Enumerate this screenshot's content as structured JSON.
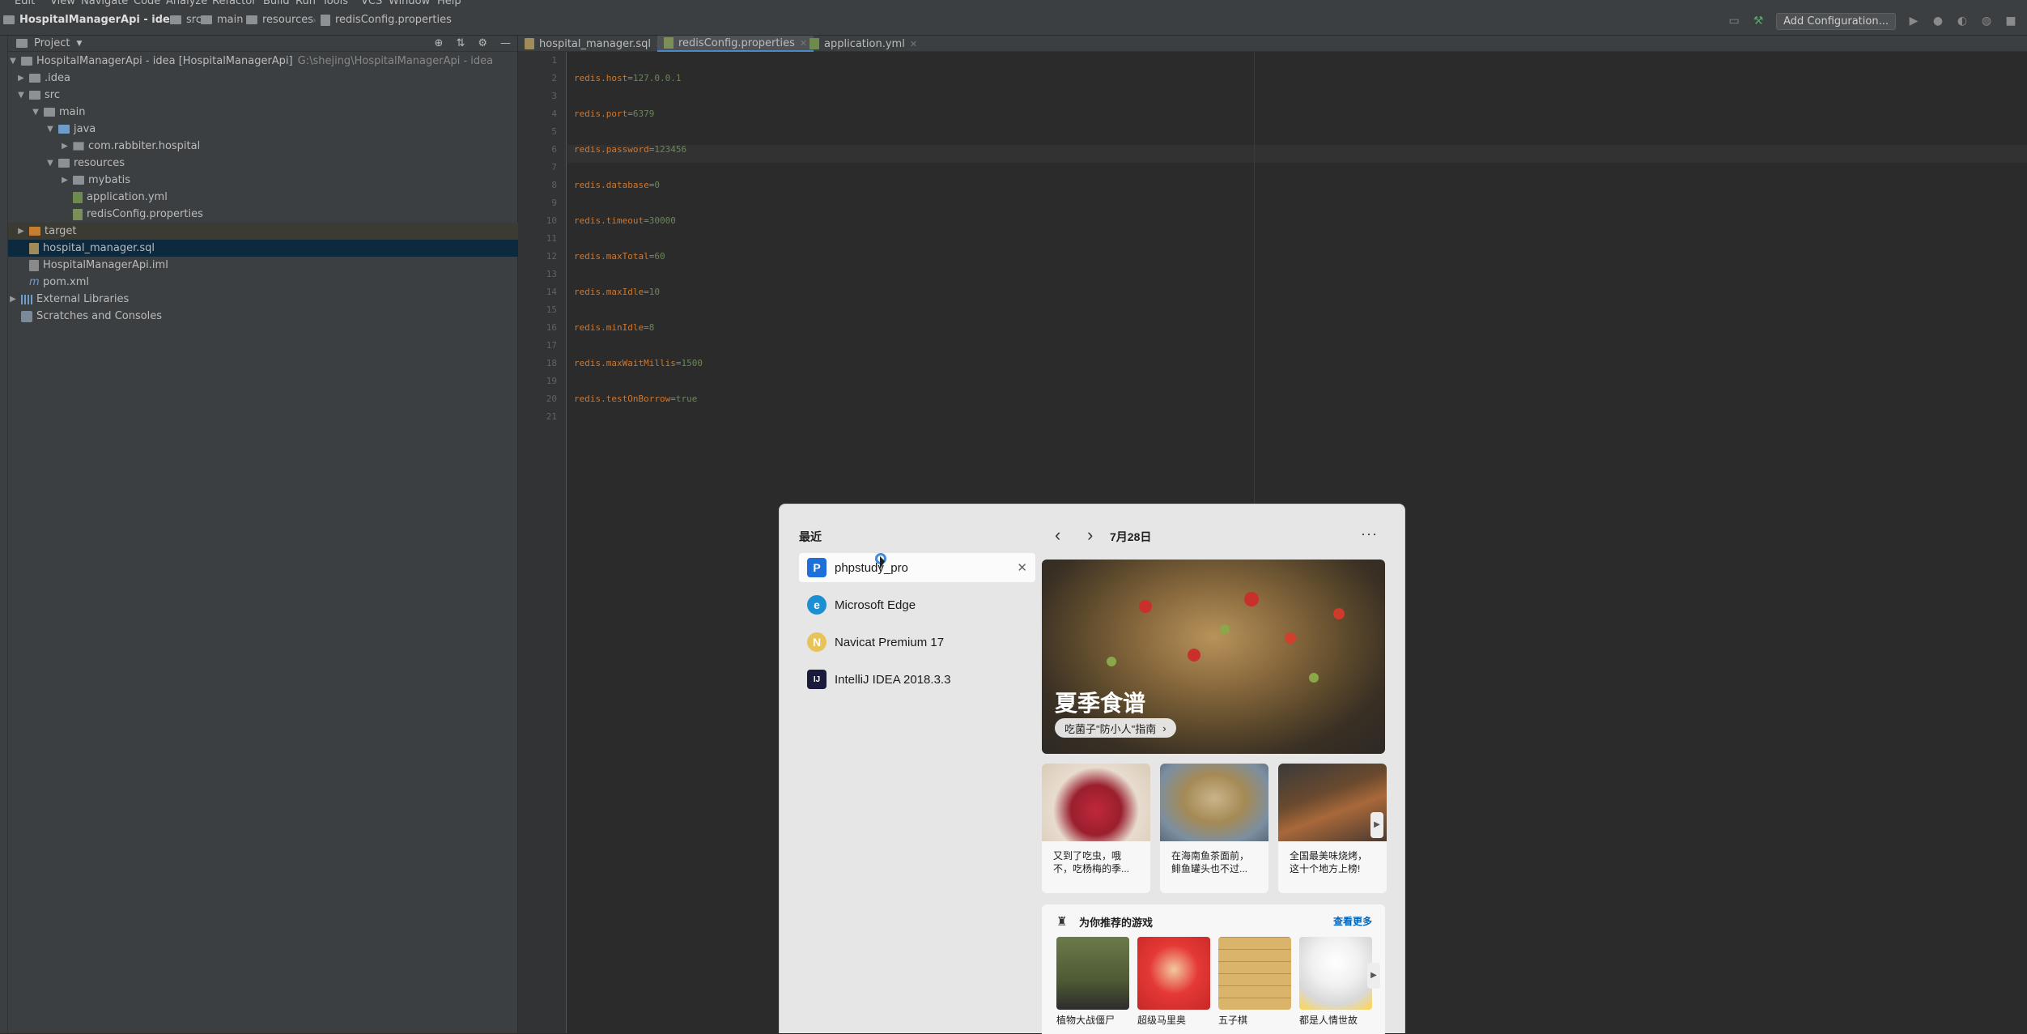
{
  "menu": [
    "Edit",
    "View",
    "Navigate",
    "Code",
    "Analyze",
    "Refactor",
    "Build",
    "Run",
    "Tools",
    "VCS",
    "Window",
    "Help"
  ],
  "breadcrumb": [
    "HospitalManagerApi - idea",
    "src",
    "main",
    "resources",
    "redisConfig.properties"
  ],
  "toolbar": {
    "add_config": "Add Configuration..."
  },
  "project": {
    "title": "Project",
    "root_label": "HospitalManagerApi - idea [HospitalManagerApi]",
    "root_path": "G:\\shejing\\HospitalManagerApi - idea",
    "items": {
      "idea": ".idea",
      "src": "src",
      "main": "main",
      "java": "java",
      "pkg": "com.rabbiter.hospital",
      "resources": "resources",
      "mybatis": "mybatis",
      "app_yml": "application.yml",
      "redis_props": "redisConfig.properties",
      "target": "target",
      "sql": "hospital_manager.sql",
      "iml": "HospitalManagerApi.iml",
      "pom": "pom.xml",
      "ext_libs": "External Libraries",
      "scratches": "Scratches and Consoles"
    }
  },
  "tabs": [
    "hospital_manager.sql",
    "redisConfig.properties",
    "application.yml"
  ],
  "editor": {
    "lines": [
      {
        "k": "redis.host=",
        "v": "127.0.0.1"
      },
      {
        "k": "redis.port=",
        "v": "6379"
      },
      {
        "k": "redis.password=",
        "v": "123456"
      },
      {
        "k": "redis.database=",
        "v": "0"
      },
      {
        "k": "redis.timeout=",
        "v": "30000"
      },
      {
        "k": "redis.maxTotal=",
        "v": "60"
      },
      {
        "k": "redis.maxIdle=",
        "v": "10"
      },
      {
        "k": "redis.minIdle=",
        "v": "8"
      },
      {
        "k": "redis.maxWaitMillis=",
        "v": "1500"
      },
      {
        "k": "redis.testOnBorrow=",
        "v": "true"
      }
    ],
    "line_numbers": [
      "1",
      "2",
      "3",
      "4",
      "5",
      "6",
      "7",
      "8",
      "9",
      "10",
      "11",
      "12",
      "13",
      "14",
      "15",
      "16",
      "17",
      "18",
      "19",
      "20",
      "21"
    ]
  },
  "start_panel": {
    "recent_title": "最近",
    "apps": [
      {
        "name": "phpstudy_pro",
        "icon": "P",
        "color": "#1e6fd9"
      },
      {
        "name": "Microsoft Edge",
        "icon": "e",
        "color": "#1b8fd1"
      },
      {
        "name": "Navicat Premium 17",
        "icon": "N",
        "color": "#e7c35a"
      },
      {
        "name": "IntelliJ IDEA 2018.3.3",
        "icon": "IJ",
        "color": "#1a1a3a"
      }
    ],
    "calendar_date": "7月28日",
    "hero_title": "夏季食谱",
    "hero_chip": "吃菌子\"防小人\"指南",
    "cards": [
      {
        "text": "又到了吃虫，哦不，吃杨梅的季..."
      },
      {
        "text": "在海南鱼茶面前，鲱鱼罐头也不过..."
      },
      {
        "text": "全国最美味烧烤，这十个地方上榜!"
      }
    ],
    "games_title": "为你推荐的游戏",
    "games_more": "查看更多",
    "games": [
      "植物大战僵尸",
      "超级马里奥",
      "五子棋",
      "都是人情世故"
    ]
  }
}
